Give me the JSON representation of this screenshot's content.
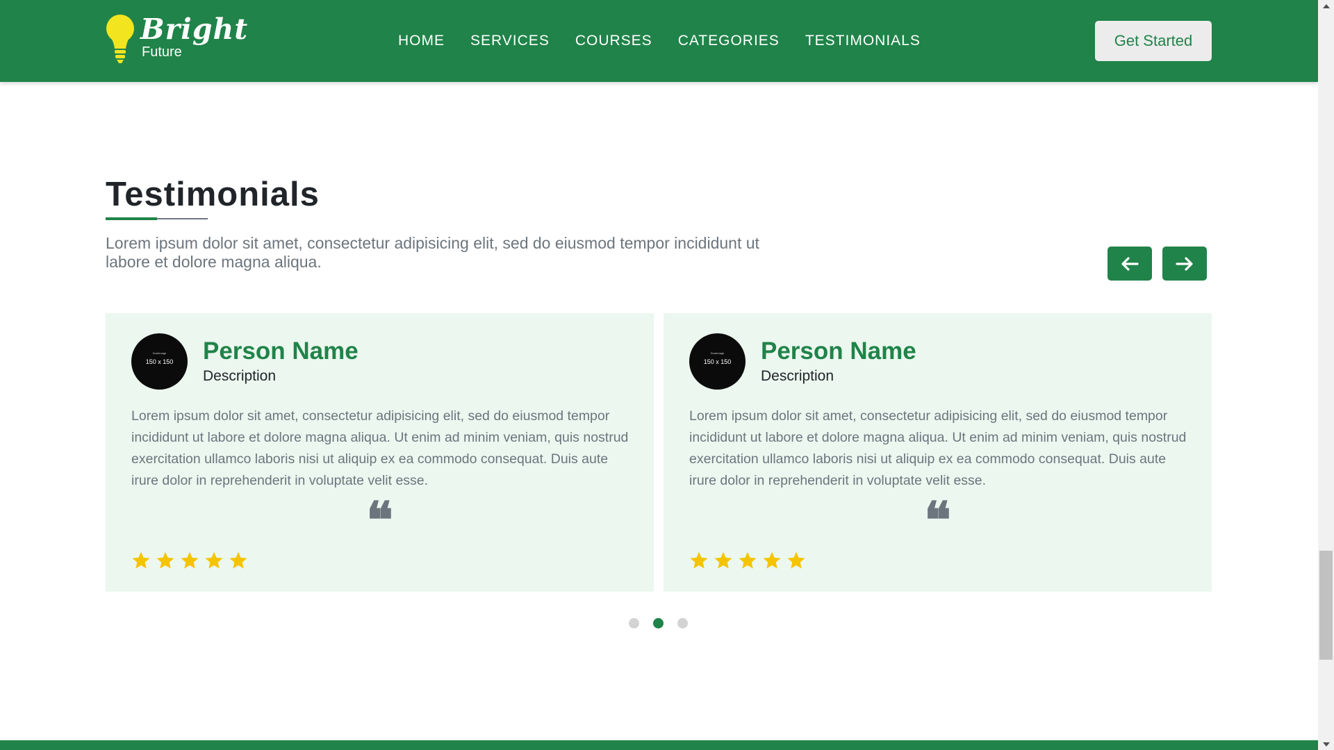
{
  "header": {
    "logo": {
      "title": "Bright",
      "subtitle": "Future"
    },
    "nav": [
      {
        "label": "HOME"
      },
      {
        "label": "SERVICES"
      },
      {
        "label": "COURSES"
      },
      {
        "label": "CATEGORIES"
      },
      {
        "label": "TESTIMONIALS"
      }
    ],
    "cta_label": "Get Started"
  },
  "testimonials": {
    "title": "Testimonials",
    "description": "Lorem ipsum dolor sit amet, consectetur adipisicing elit, sed do eiusmod tempor incididunt ut labore et dolore magna aliqua.",
    "prev_icon": "arrow-left-icon",
    "next_icon": "arrow-right-icon",
    "cards": [
      {
        "avatar_placeholder": "150 x 150",
        "name": "Person Name",
        "role": "Description",
        "text": "Lorem ipsum dolor sit amet, consectetur adipisicing elit, sed do eiusmod tempor incididunt ut labore et dolore magna aliqua. Ut enim ad minim veniam, quis nostrud exercitation ullamco laboris nisi ut aliquip ex ea commodo consequat. Duis aute irure dolor in reprehenderit in voluptate velit esse.",
        "quote_icon": "❝",
        "rating": 5
      },
      {
        "avatar_placeholder": "150 x 150",
        "name": "Person Name",
        "role": "Description",
        "text": "Lorem ipsum dolor sit amet, consectetur adipisicing elit, sed do eiusmod tempor incididunt ut labore et dolore magna aliqua. Ut enim ad minim veniam, quis nostrud exercitation ullamco laboris nisi ut aliquip ex ea commodo consequat. Duis aute irure dolor in reprehenderit in voluptate velit esse.",
        "quote_icon": "❝",
        "rating": 5
      }
    ],
    "pagination": {
      "count": 3,
      "active_index": 1
    }
  },
  "colors": {
    "brand_green": "#208349",
    "card_bg": "#ebf7ef",
    "star": "#f5c400",
    "bulb": "#f2e51f",
    "muted_text": "#6c757d"
  }
}
